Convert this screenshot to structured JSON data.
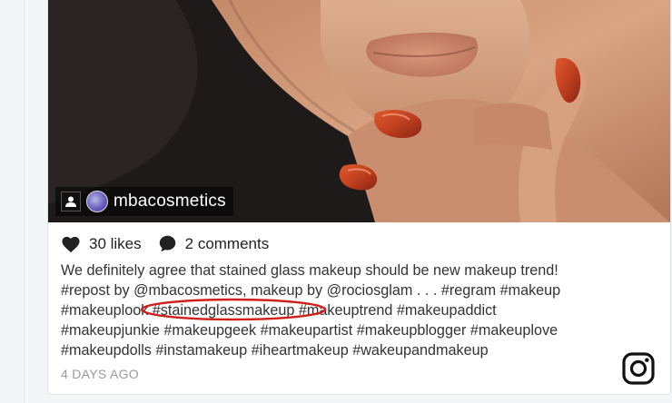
{
  "post": {
    "username": "mbacosmetics",
    "likes": "30 likes",
    "comments": "2 comments",
    "caption_lines": [
      "We definitely agree that stained glass makeup should be new makeup trend!",
      "#repost by @mbacosmetics, makeup by @rociosglam . . . #regram #makeup",
      "#makeuplook ",
      "#stainedglassmakeup",
      " #makeuptrend #makeupaddict",
      "#makeupjunkie #makeupgeek #makeupartist #makeupblogger #makeuplove",
      "#makeupdolls #instamakeup #iheartmakeup #wakeupandmakeup"
    ],
    "timestamp": "4 DAYS AGO"
  },
  "icons": {
    "like": "heart-icon",
    "comment": "comment-bubble-icon",
    "platform": "instagram-icon",
    "user_badge": "person-icon"
  },
  "colors": {
    "highlight_ellipse": "#d0201b",
    "text": "#333333",
    "muted": "#999999",
    "nail_polish": "#c0401f"
  }
}
